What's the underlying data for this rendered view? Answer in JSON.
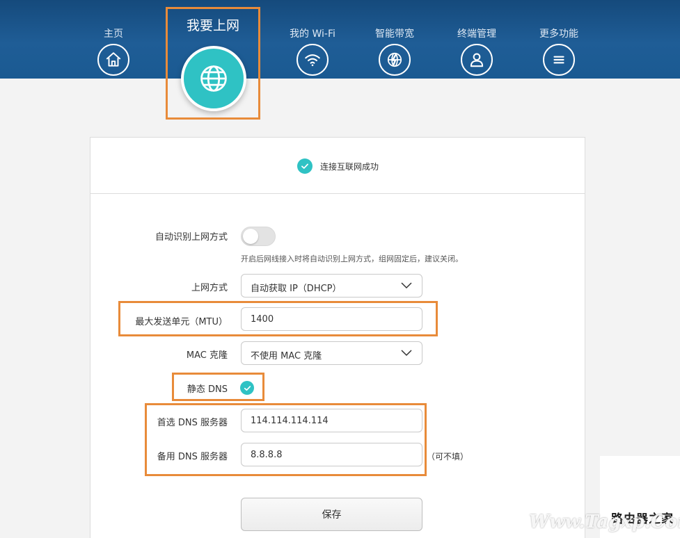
{
  "nav": {
    "items": [
      {
        "label": "主页",
        "icon": "home-icon"
      },
      {
        "label": "我要上网",
        "icon": "globe-icon"
      },
      {
        "label": "我的 Wi-Fi",
        "icon": "wifi-icon"
      },
      {
        "label": "智能带宽",
        "icon": "bandwidth-globe-icon"
      },
      {
        "label": "终端管理",
        "icon": "user-icon"
      },
      {
        "label": "更多功能",
        "icon": "menu-icon"
      }
    ],
    "active_index": 1
  },
  "status": {
    "text": "连接互联网成功",
    "icon": "check-circle-icon"
  },
  "form": {
    "auto_detect": {
      "label": "自动识别上网方式",
      "enabled": false,
      "hint": "开启后网线接入时将自动识别上网方式，组网固定后，建议关闭。"
    },
    "wan_mode": {
      "label": "上网方式",
      "value": "自动获取 IP（DHCP）"
    },
    "mtu": {
      "label": "最大发送单元（MTU）",
      "value": "1400"
    },
    "mac_clone": {
      "label": "MAC 克隆",
      "value": "不使用 MAC 克隆"
    },
    "static_dns": {
      "label": "静态 DNS",
      "checked": true
    },
    "primary_dns": {
      "label": "首选 DNS 服务器",
      "value": "114.114.114.114"
    },
    "secondary_dns": {
      "label": "备用 DNS 服务器",
      "value": "8.8.8.8",
      "note": "（可不填）"
    },
    "save_label": "保存"
  },
  "watermark": {
    "line1": "路由器之家",
    "line2": "Www.Tagxp.Com"
  },
  "colors": {
    "header": "#1f5d96",
    "accent": "#2fc2c4",
    "highlight": "#e88b3a"
  }
}
